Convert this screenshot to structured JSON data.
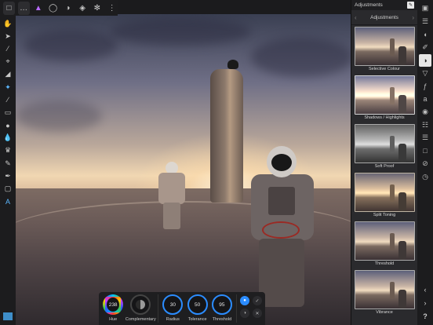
{
  "toolbar": {
    "more_label": "…",
    "icons": [
      "document-icon",
      "more-icon",
      "affinity-logo-icon",
      "liquify-persona-icon",
      "develop-persona-icon",
      "tone-mapping-persona-icon",
      "export-persona-icon",
      "share-icon"
    ]
  },
  "studio": {
    "header_title": "Adjustments",
    "nav_title": "Adjustments",
    "presets": [
      {
        "label": "Selective Colour",
        "style": ""
      },
      {
        "label": "Shadows / Highlights",
        "style": "bright"
      },
      {
        "label": "Soft Proof",
        "style": "bw"
      },
      {
        "label": "Split Toning",
        "style": "warm"
      },
      {
        "label": "Threshold",
        "style": ""
      },
      {
        "label": "Vibrance",
        "style": ""
      }
    ]
  },
  "context": {
    "hue": {
      "value": "238",
      "label": "Hue"
    },
    "complementary": {
      "label": "Complementary"
    },
    "radius": {
      "value": "30",
      "unit": "px",
      "label": "Radius"
    },
    "tolerance": {
      "value": "50",
      "unit": "%",
      "label": "Tolerance"
    },
    "threshold": {
      "value": "95",
      "unit": "%",
      "label": "Threshold"
    }
  },
  "help": {
    "label": "?"
  },
  "colors": {
    "accent": "#2b8cff",
    "panel": "#2a2a2d",
    "toolbar": "#1c1c1e"
  }
}
